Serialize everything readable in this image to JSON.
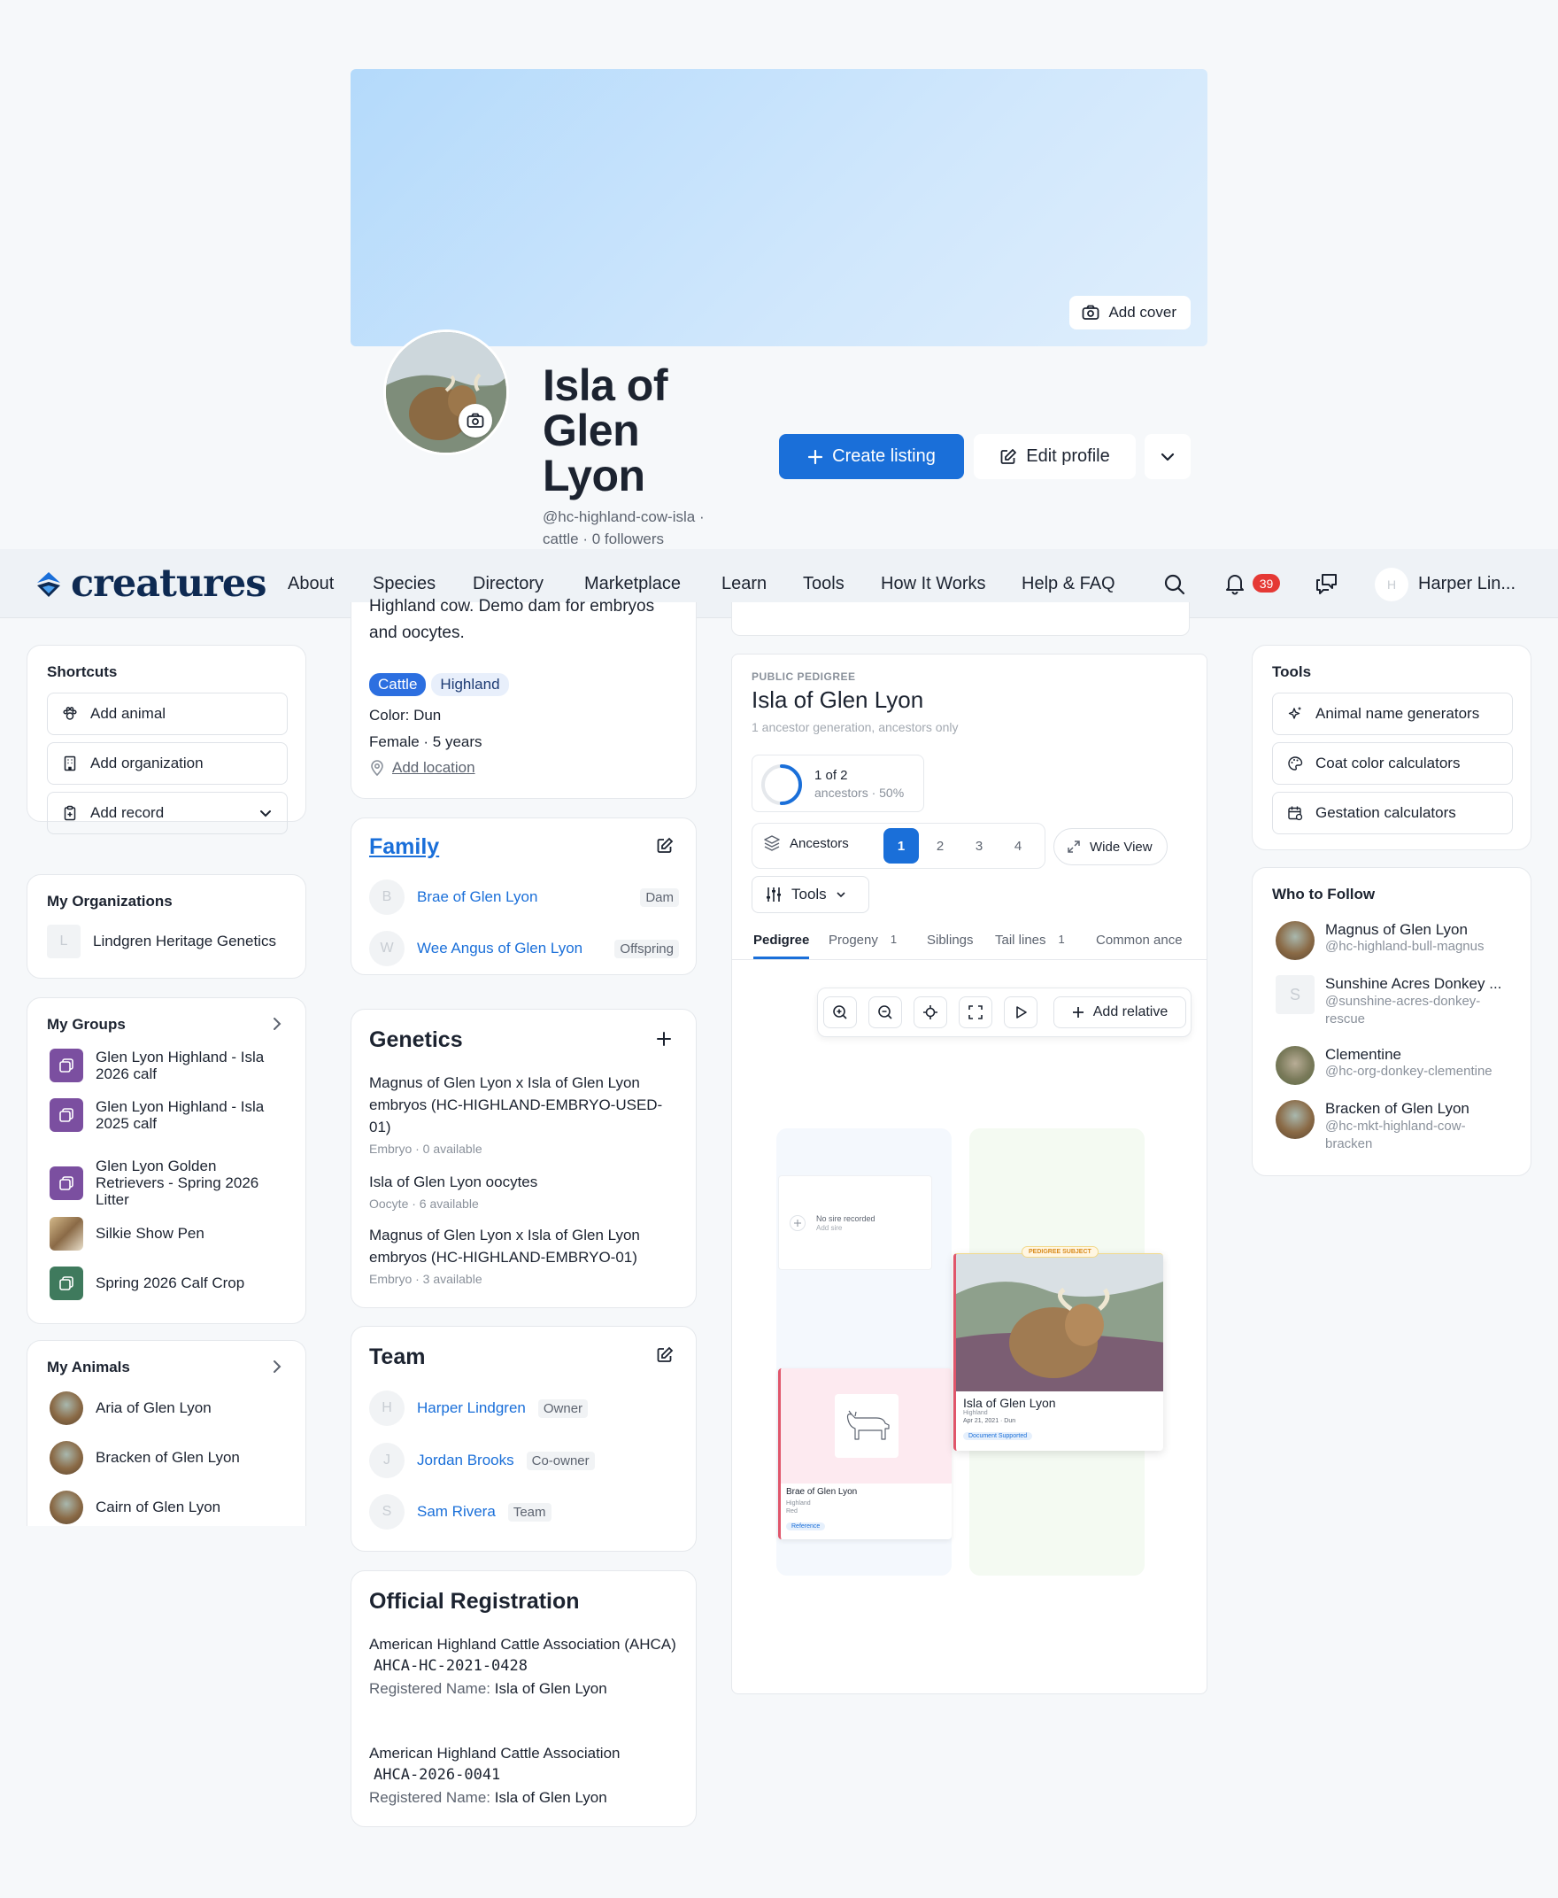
{
  "profile": {
    "add_cover": "Add cover",
    "name": "Isla of Glen Lyon",
    "handle": "@hc-highland-cow-isla · cattle · 0 followers",
    "create_listing": "Create listing",
    "edit_profile": "Edit profile"
  },
  "nav": {
    "logo": "creatures",
    "items": [
      "About",
      "Species",
      "Directory",
      "Marketplace",
      "Learn",
      "Tools",
      "How It Works",
      "Help & FAQ"
    ],
    "notif_count": "39",
    "user_initial": "H",
    "user_name": "Harper Lin..."
  },
  "shortcuts": {
    "title": "Shortcuts",
    "items": [
      "Add animal",
      "Add organization",
      "Add record"
    ]
  },
  "orgs": {
    "title": "My Organizations",
    "items": [
      {
        "initial": "L",
        "name": "Lindgren Heritage Genetics"
      }
    ]
  },
  "groups": {
    "title": "My Groups",
    "items": [
      "Glen Lyon Highland - Isla 2026 calf",
      "Glen Lyon Highland - Isla 2025 calf",
      "Glen Lyon Golden Retrievers - Spring 2026 Litter",
      "Silkie Show Pen",
      "Spring 2026 Calf Crop"
    ]
  },
  "animals": {
    "title": "My Animals",
    "items": [
      "Aria of Glen Lyon",
      "Bracken of Glen Lyon",
      "Cairn of Glen Lyon"
    ]
  },
  "about": {
    "desc": "Highland cow. Demo dam for embryos and oocytes.",
    "tags": [
      "Cattle",
      "Highland"
    ],
    "color": "Color: Dun",
    "sex_age": "Female · 5 years",
    "add_location": "Add location"
  },
  "family": {
    "title": "Family",
    "members": [
      {
        "initial": "B",
        "name": "Brae of Glen Lyon",
        "role": "Dam"
      },
      {
        "initial": "W",
        "name": "Wee Angus of Glen Lyon",
        "role": "Offspring"
      }
    ]
  },
  "genetics": {
    "title": "Genetics",
    "items": [
      {
        "name": "Magnus of Glen Lyon x Isla of Glen Lyon embryos (HC-HIGHLAND-EMBRYO-USED-01)",
        "meta": "Embryo · 0 available"
      },
      {
        "name": "Isla of Glen Lyon oocytes",
        "meta": "Oocyte · 6 available"
      },
      {
        "name": "Magnus of Glen Lyon x Isla of Glen Lyon embryos (HC-HIGHLAND-EMBRYO-01)",
        "meta": "Embryo · 3 available"
      }
    ]
  },
  "team": {
    "title": "Team",
    "members": [
      {
        "initial": "H",
        "name": "Harper Lindgren",
        "role": "Owner"
      },
      {
        "initial": "J",
        "name": "Jordan Brooks",
        "role": "Co-owner"
      },
      {
        "initial": "S",
        "name": "Sam Rivera",
        "role": "Team"
      }
    ]
  },
  "registration": {
    "title": "Official Registration",
    "entries": [
      {
        "assoc": "American Highland Cattle Association (AHCA)",
        "code": "AHCA-HC-2021-0428",
        "label": "Registered Name:",
        "name": "Isla of Glen Lyon"
      },
      {
        "assoc": "American Highland Cattle Association",
        "code": "AHCA-2026-0041",
        "label": "Registered Name:",
        "name": "Isla of Glen Lyon"
      }
    ]
  },
  "pedigree": {
    "kicker": "PUBLIC PEDIGREE",
    "title": "Isla of Glen Lyon",
    "subtitle": "1 ancestor generation, ancestors only",
    "progress_label": "1 of 2",
    "progress_sub": "ancestors · 50%",
    "progress_fraction": 0.5,
    "ancestors": "Ancestors",
    "pages": [
      "1",
      "2",
      "3",
      "4"
    ],
    "wide_view": "Wide View",
    "tools": "Tools",
    "tabs": [
      {
        "label": "Pedigree",
        "count": ""
      },
      {
        "label": "Progeny",
        "count": "1"
      },
      {
        "label": "Siblings",
        "count": ""
      },
      {
        "label": "Tail lines",
        "count": "1"
      },
      {
        "label": "Common ance",
        "count": ""
      }
    ],
    "add_relative": "Add relative",
    "no_sire": "No sire recorded",
    "add_sire": "Add sire",
    "subject_tag": "PEDIGREE SUBJECT",
    "subject_name": "Isla of Glen Lyon",
    "subject_breed": "Highland",
    "subject_meta": "Apr 21, 2021 · Dun",
    "subject_badge": "Document Supported",
    "dam_name": "Brae of Glen Lyon",
    "dam_breed": "Highland",
    "dam_color": "Red",
    "dam_badge": "Reference"
  },
  "tools": {
    "title": "Tools",
    "items": [
      "Animal name generators",
      "Coat color calculators",
      "Gestation calculators"
    ]
  },
  "follow": {
    "title": "Who to Follow",
    "items": [
      {
        "name": "Magnus of Glen Lyon",
        "handle": "@hc-highland-bull-magnus"
      },
      {
        "name": "Sunshine Acres Donkey ...",
        "handle": "@sunshine-acres-donkey-rescue",
        "initial": "S"
      },
      {
        "name": "Clementine",
        "handle": "@hc-org-donkey-clementine"
      },
      {
        "name": "Bracken of Glen Lyon",
        "handle": "@hc-mkt-highland-cow-bracken"
      }
    ]
  }
}
